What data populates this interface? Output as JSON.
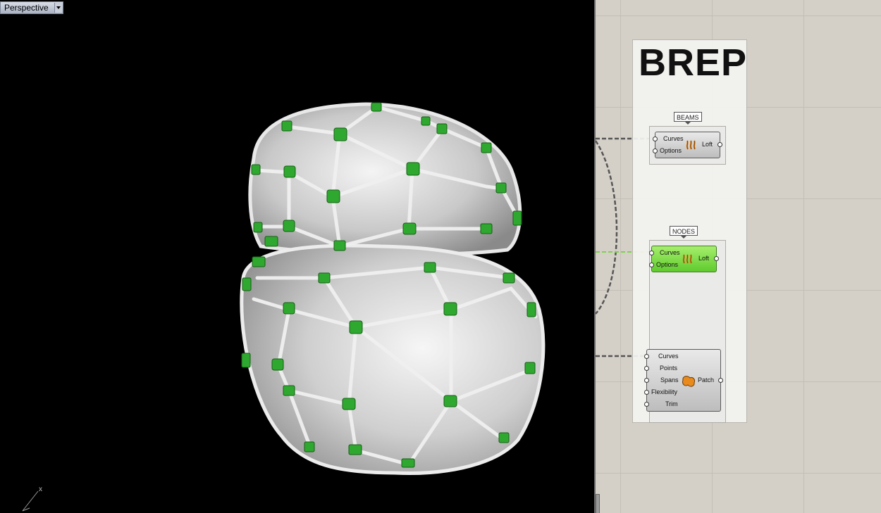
{
  "viewport": {
    "label": "Perspective",
    "axis_label": "x"
  },
  "grasshopper": {
    "group_title": "BREP",
    "components": [
      {
        "tag": "BEAMS",
        "name": "Loft",
        "inputs": [
          "Curves",
          "Options"
        ],
        "icon": "loft-icon",
        "state": "normal"
      },
      {
        "tag": "NODES",
        "name": "Loft",
        "inputs": [
          "Curves",
          "Options"
        ],
        "icon": "loft-icon",
        "state": "selected"
      },
      {
        "tag": "",
        "name": "Patch",
        "inputs": [
          "Curves",
          "Points",
          "Spans",
          "Flexibility",
          "Trim"
        ],
        "icon": "patch-icon",
        "state": "normal"
      }
    ]
  },
  "colors": {
    "viewport_bg": "#000000",
    "node_green": "#2fa82f",
    "selected_component": "#6fd83a",
    "canvas_bg": "#d4d0c8"
  }
}
